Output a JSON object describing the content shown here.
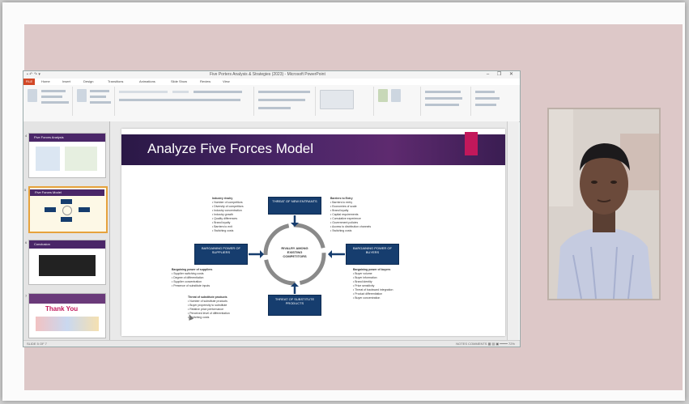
{
  "window": {
    "title": "Five Porters Analysis & Strategies (2023) - Microsoft PowerPoint",
    "qat": "▪ ↶ ↷ ▾",
    "controls": "– ❐ ✕"
  },
  "ribbon_tabs": [
    "FILE",
    "Home",
    "Insert",
    "Design",
    "Transitions",
    "Animations",
    "Slide Show",
    "Review",
    "View"
  ],
  "slide": {
    "title": "Analyze Five Forces Model",
    "center_label": "RIVALRY AMONG EXISTING COMPETITORS",
    "forces": {
      "top": "THREAT OF NEW ENTRANTS",
      "left": "BARGAINING POWER OF SUPPLIERS",
      "right": "BARGAINING POWER OF BUYERS",
      "bottom": "THREAT OF SUBSTITUTE PRODUCTS"
    },
    "rivalry_notes": {
      "heading": "Industry rivalry",
      "items": [
        "Number of competitors",
        "Diversity of competitors",
        "Industry concentration",
        "Industry growth",
        "Quality differences",
        "Brand loyalty",
        "Barriers to exit",
        "Switching costs"
      ]
    },
    "entrants_notes": {
      "heading": "Barriers to Entry",
      "items": [
        "Barriers to entry",
        "Economies of scale",
        "Brand loyalty",
        "Capital requirements",
        "Cumulative experience",
        "Government policies",
        "Access to distribution channels",
        "Switching costs"
      ]
    },
    "suppliers_notes": {
      "heading": "Bargaining power of suppliers",
      "items": [
        "Supplier switching costs",
        "Degree of differentiation",
        "Supplier concentration",
        "Presence of substitute inputs"
      ]
    },
    "substitutes_notes": {
      "heading": "Threat of substitute products",
      "items": [
        "Number of substitute products",
        "Buyer propensity to substitute",
        "Relative price performance",
        "Perceived level of differentiation",
        "Switching costs"
      ]
    },
    "buyers_notes": {
      "heading": "Bargaining power of buyers",
      "items": [
        "Buyer volume",
        "Buyer information",
        "Brand identity",
        "Price sensitivity",
        "Threat of backward integration",
        "Product differentiation",
        "Buyer concentration"
      ]
    }
  },
  "thumbnails": [
    {
      "num": "4",
      "title": "Five Forces Analysis"
    },
    {
      "num": "5",
      "title": "Five Forces Model"
    },
    {
      "num": "6",
      "title": "Conclusion"
    },
    {
      "num": "7",
      "title": "Thank You"
    }
  ],
  "status": {
    "left": "SLIDE 5 OF 7",
    "right": "NOTES  COMMENTS  ▦ ▤ ▣  ━━━━  72%"
  },
  "colors": {
    "stage": "#ddc8c8",
    "banner": "#4a2668",
    "accent": "#c2185b",
    "force_box": "#163d6e",
    "file_tab": "#d24726"
  }
}
